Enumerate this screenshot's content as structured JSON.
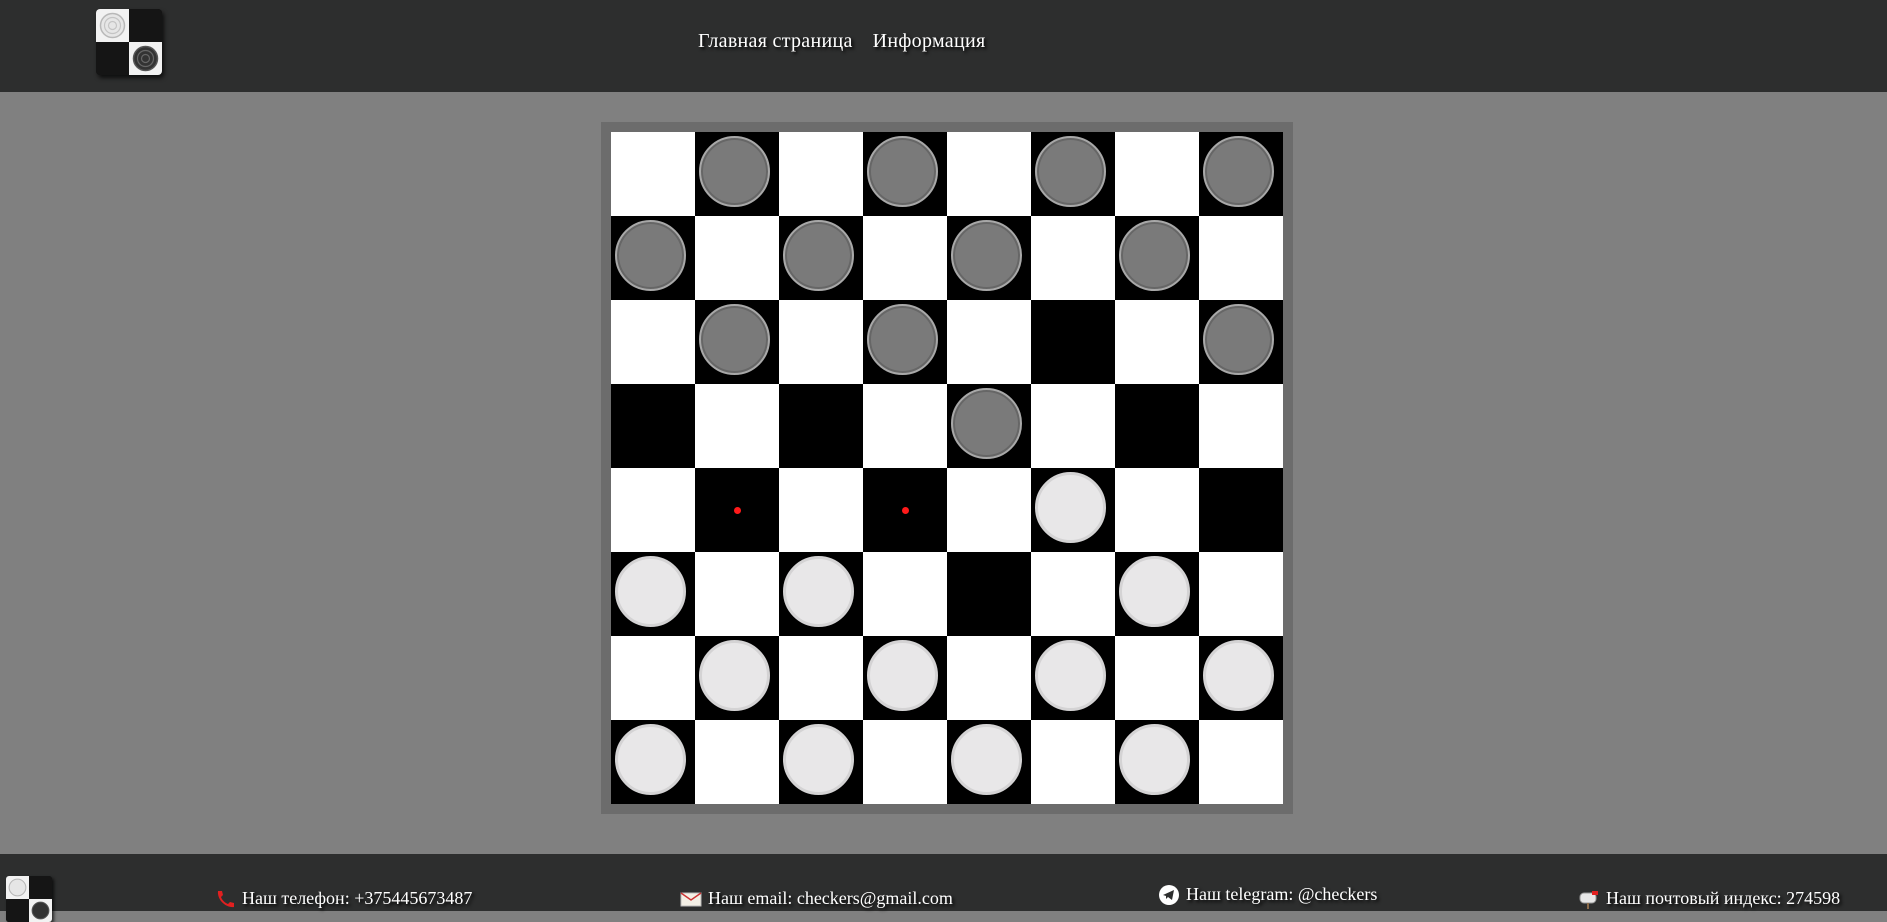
{
  "nav": {
    "home_label": "Главная страница",
    "info_label": "Информация"
  },
  "logo": {
    "icon": "checkers-logo-icon"
  },
  "board": {
    "size": 8,
    "colors": {
      "light_square": "#ffffff",
      "dark_square": "#000000",
      "frame": "#6c6c6c",
      "black_piece": "#7a7a7a",
      "white_piece": "#e8e7e8",
      "move_hint": "#ff1a1a"
    },
    "rows": [
      [
        "",
        "b",
        "",
        "b",
        "",
        "b",
        "",
        "b"
      ],
      [
        "b",
        "",
        "b",
        "",
        "b",
        "",
        "b",
        ""
      ],
      [
        "",
        "b",
        "",
        "b",
        "",
        "",
        "",
        "b"
      ],
      [
        "",
        "",
        "",
        "",
        "b",
        "",
        "",
        ""
      ],
      [
        "",
        "h",
        "",
        "h",
        "",
        "w",
        "",
        ""
      ],
      [
        "w",
        "",
        "w",
        "",
        "",
        "",
        "w",
        ""
      ],
      [
        "",
        "w",
        "",
        "w",
        "",
        "w",
        "",
        "w"
      ],
      [
        "w",
        "",
        "w",
        "",
        "w",
        "",
        "w",
        ""
      ]
    ],
    "legend": {
      "b": "black-piece",
      "w": "white-piece",
      "h": "move-hint"
    }
  },
  "footer": {
    "phone": {
      "icon": "phone-icon",
      "text": "Наш телефон: +375445673487"
    },
    "email": {
      "icon": "envelope-icon",
      "text": "Наш email: checkers@gmail.com"
    },
    "telegram": {
      "icon": "telegram-icon",
      "text": "Наш telegram: @checkers"
    },
    "postal": {
      "icon": "mailbox-icon",
      "text": "Наш почтовый индекс: 274598"
    }
  }
}
